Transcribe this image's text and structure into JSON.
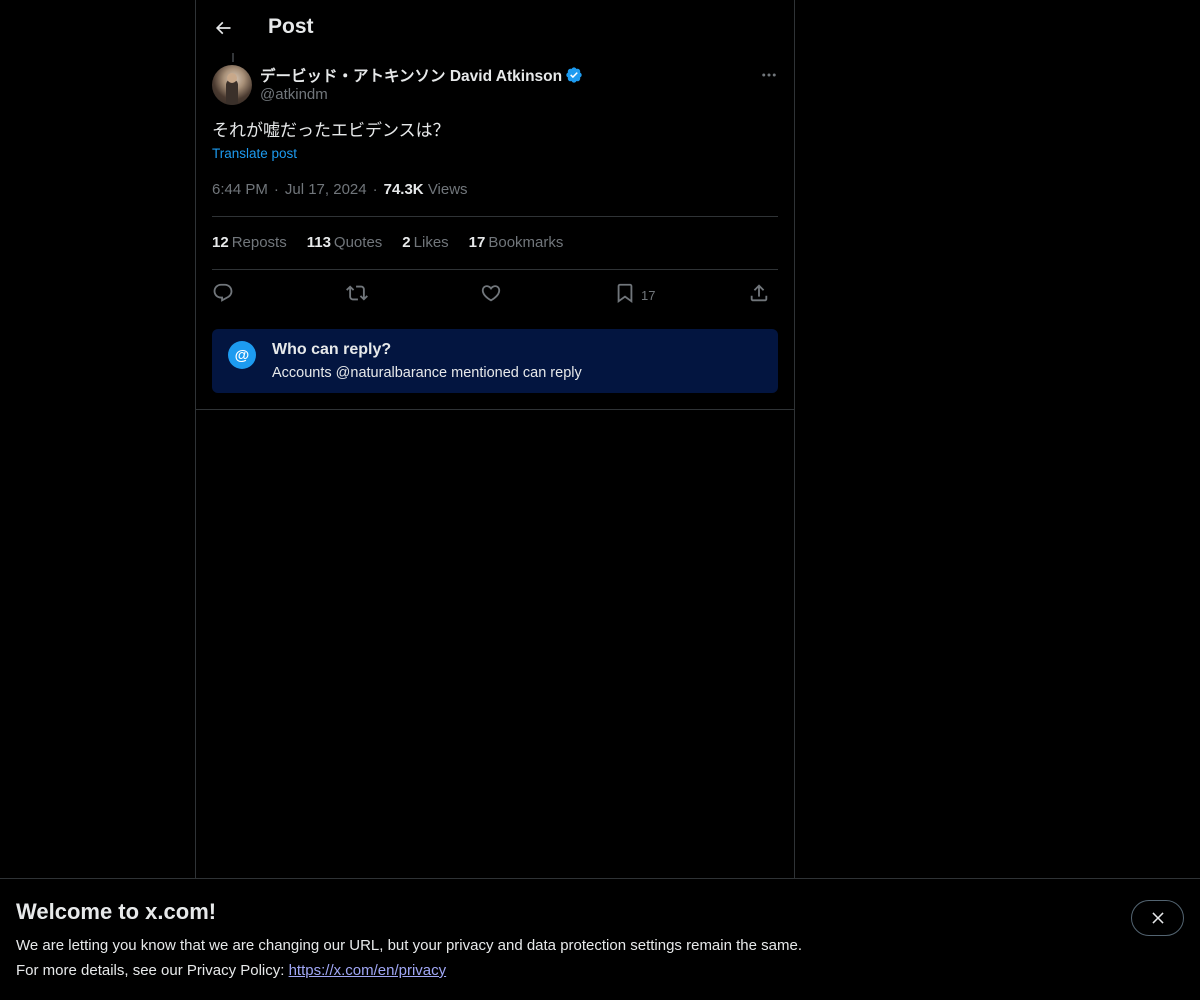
{
  "header": {
    "title": "Post",
    "back_icon": "arrow-left-icon"
  },
  "post": {
    "author_name": "デービッド・アトキンソン David Atkinson",
    "handle": "@atkindm",
    "verified": true,
    "text": "それが嘘だったエビデンスは？",
    "translate_label": "Translate post",
    "time": "6:44 PM",
    "date": "Jul 17, 2024",
    "views_count": "74.3K",
    "views_label": "Views",
    "dot": "·"
  },
  "stats": {
    "reposts_count": "12",
    "reposts_label": "Reposts",
    "quotes_count": "113",
    "quotes_label": "Quotes",
    "likes_count": "2",
    "likes_label": "Likes",
    "bookmarks_count": "17",
    "bookmarks_label": "Bookmarks"
  },
  "actions": {
    "bookmark_count": "17"
  },
  "reply_restriction": {
    "icon_text": "@",
    "title": "Who can reply?",
    "description": "Accounts @naturalbarance mentioned can reply"
  },
  "banner": {
    "title": "Welcome to x.com!",
    "line1": "We are letting you know that we are changing our URL, but your privacy and data protection settings remain the same.",
    "line2_prefix": "For more details, see our Privacy Policy: ",
    "link": "https://x.com/en/privacy"
  },
  "colors": {
    "background": "#000000",
    "accent": "#1d9bf0",
    "text_primary": "#e7e9ea",
    "text_secondary": "#71767b",
    "reply_box": "#031540"
  }
}
